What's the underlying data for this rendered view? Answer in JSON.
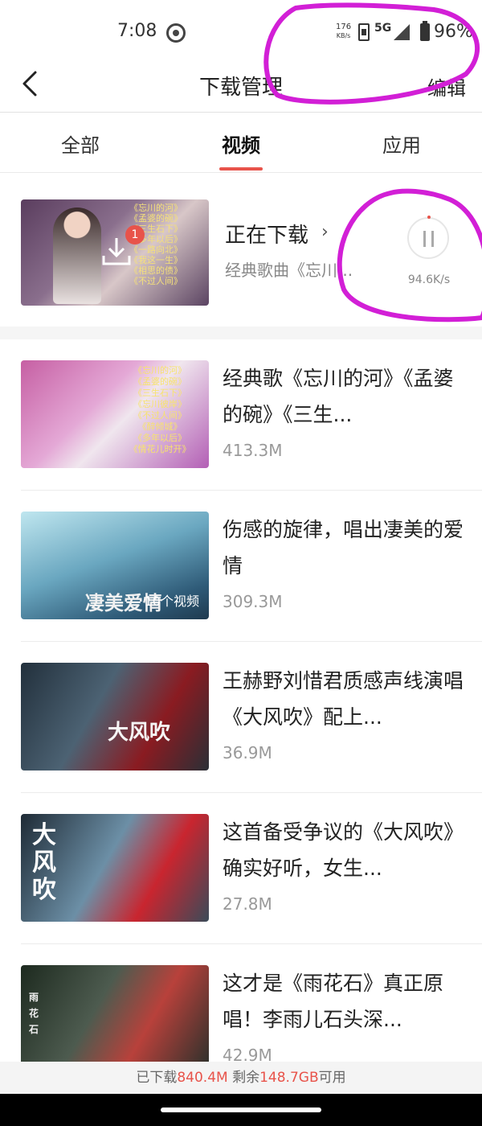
{
  "status_bar": {
    "time": "7:08",
    "net_speed_value": "176",
    "net_speed_unit": "KB/s",
    "network_type": "5G",
    "battery": "96%"
  },
  "header": {
    "title": "下载管理",
    "edit_label": "编辑"
  },
  "tabs": [
    {
      "label": "全部",
      "active": false
    },
    {
      "label": "视频",
      "active": true
    },
    {
      "label": "应用",
      "active": false
    }
  ],
  "downloading": {
    "status_label": "正在下载",
    "subtitle": "经典歌曲《忘川...",
    "count": "1",
    "speed": "94.6K/s",
    "thumb_lyrics": [
      "《忘川的河》",
      "《孟婆的碗》",
      "《三生石下》",
      "《多年以后》",
      "《一路向北》",
      "《我这一生》",
      "《相思的债》",
      "《不过人间》"
    ]
  },
  "items": [
    {
      "title": "经典歌《忘川的河》《孟婆的碗》《三生...",
      "size": "413.3M",
      "thumb_lyrics": [
        "《忘川的河》",
        "《孟婆的碗》",
        "《三生石下》",
        "《忘川彼岸》",
        "《不过人间》",
        "《醉倾城》",
        "《多年以后》",
        "《情花儿时开》"
      ]
    },
    {
      "title": "伤感的旋律，唱出凄美的爱情",
      "size": "309.3M",
      "thumb_text": "凄美爱情",
      "badge": "10个视频"
    },
    {
      "title": "王赫野刘惜君质感声线演唱《大风吹》配上...",
      "size": "36.9M",
      "thumb_text": "大风吹"
    },
    {
      "title": "这首备受争议的《大风吹》确实好听，女生...",
      "size": "27.8M",
      "thumb_text": "大风吹"
    },
    {
      "title": "这才是《雨花石》真正原唱！李雨儿石头深...",
      "size": "42.9M",
      "thumb_text": "雨花石"
    }
  ],
  "footer": {
    "prefix": "已下载",
    "downloaded": "840.4M",
    "middle": " 剩余",
    "remaining": "148.7GB",
    "suffix": "可用"
  },
  "colors": {
    "accent": "#e8534a",
    "annotation": "#d21fd6"
  }
}
